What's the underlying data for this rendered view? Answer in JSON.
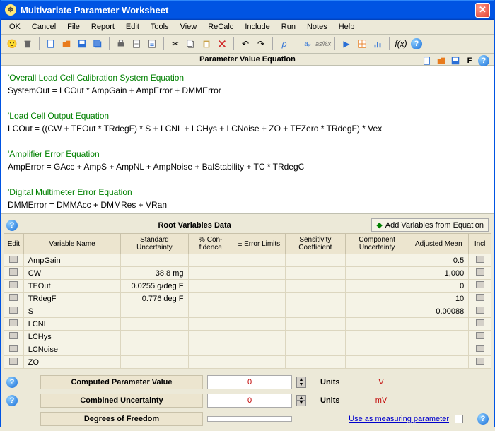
{
  "window": {
    "title": "Multivariate Parameter Worksheet"
  },
  "menu": {
    "ok": "OK",
    "cancel": "Cancel",
    "file": "File",
    "report": "Report",
    "edit": "Edit",
    "tools": "Tools",
    "view": "View",
    "recalc": "ReCalc",
    "include": "Include",
    "run": "Run",
    "notes": "Notes",
    "help": "Help"
  },
  "sections": {
    "equation_title": "Parameter Value Equation",
    "root_vars_title": "Root Variables Data",
    "add_vars_btn": "Add Variables from Equation"
  },
  "equations": {
    "c1": "'Overall Load Cell Calibration System Equation",
    "l1": "SystemOut = LCOut * AmpGain + AmpError + DMMError",
    "c2": "'Load Cell Output Equation",
    "l2": "LCOut = ((CW + TEOut * TRdegF) * S + LCNL + LCHys + LCNoise + ZO + TEZero * TRdegF) * Vex",
    "c3": "'Amplifier Error Equation",
    "l3": "AmpError = GAcc + AmpS + AmpNL + AmpNoise + BalStability + TC * TRdegC",
    "c4": "'Digital Multimeter Error Equation",
    "l4": "DMMError = DMMAcc + DMMRes + VRan"
  },
  "columns": {
    "edit": "Edit",
    "name": "Variable Name",
    "std_unc": "Standard Uncertainty",
    "conf": "% Con- fidence",
    "err_lim": "± Error Limits",
    "sens": "Sensitivity Coefficient",
    "comp_unc": "Component Uncertainty",
    "adj_mean": "Adjusted Mean",
    "incl": "Incl"
  },
  "rows": [
    {
      "name": "AmpGain",
      "std_unc": "",
      "adj_mean": "0.5"
    },
    {
      "name": "CW",
      "std_unc": "38.8 mg",
      "adj_mean": "1,000"
    },
    {
      "name": "TEOut",
      "std_unc": "0.0255 g/deg F",
      "adj_mean": "0"
    },
    {
      "name": "TRdegF",
      "std_unc": "0.776 deg F",
      "adj_mean": "10"
    },
    {
      "name": "S",
      "std_unc": "",
      "adj_mean": "0.00088"
    },
    {
      "name": "LCNL",
      "std_unc": "",
      "adj_mean": ""
    },
    {
      "name": "LCHys",
      "std_unc": "",
      "adj_mean": ""
    },
    {
      "name": "LCNoise",
      "std_unc": "",
      "adj_mean": ""
    },
    {
      "name": "ZO",
      "std_unc": "",
      "adj_mean": ""
    }
  ],
  "summary": {
    "computed_label": "Computed Parameter Value",
    "computed_value": "0",
    "computed_units_label": "Units",
    "computed_units": "V",
    "combined_label": "Combined Uncertainty",
    "combined_value": "0",
    "combined_units_label": "Units",
    "combined_units": "mV",
    "dof_label": "Degrees of Freedom",
    "dof_value": "",
    "use_as_measuring": "Use as measuring parameter"
  },
  "fx_label": "f(x)"
}
